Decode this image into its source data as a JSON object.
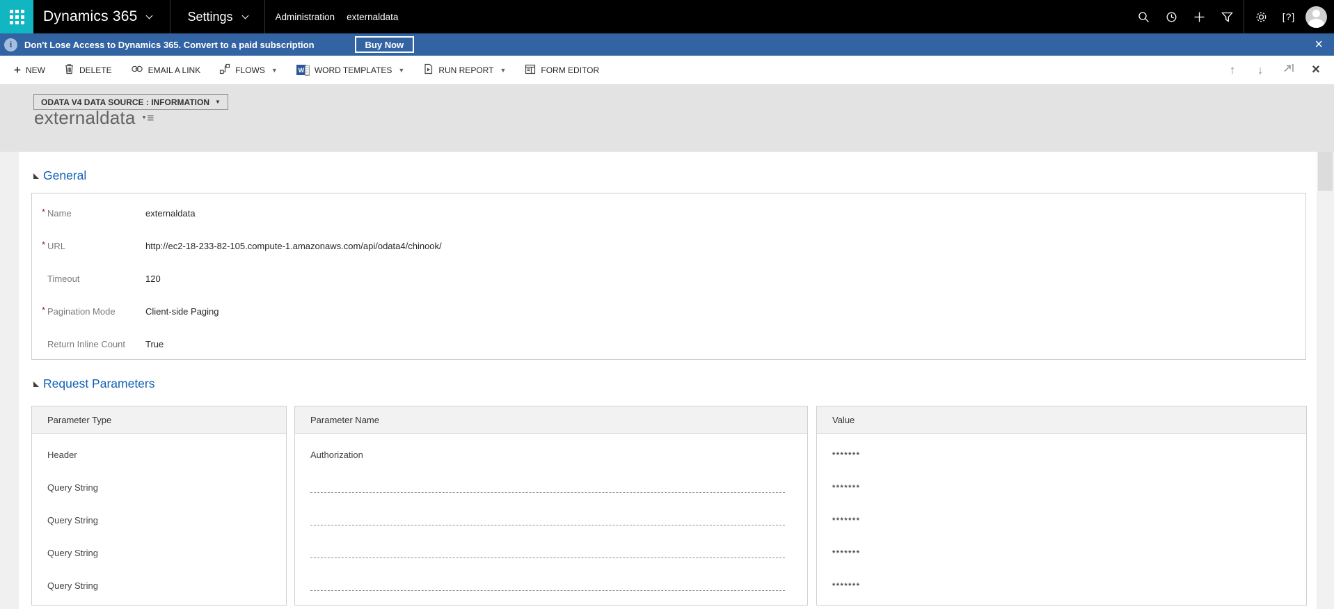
{
  "topbar": {
    "brand": "Dynamics 365",
    "area": "Settings",
    "breadcrumb": [
      "Administration",
      "externaldata"
    ],
    "icons": [
      "app-launcher-waffle",
      "search",
      "recent-history",
      "quick-create-plus",
      "advanced-find-filter",
      "settings-gear",
      "help",
      "user-avatar"
    ]
  },
  "banner": {
    "message": "Don't Lose Access to Dynamics 365. Convert to a paid subscription",
    "cta_label": "Buy Now",
    "close_glyph": "×"
  },
  "toolbar": {
    "items": [
      {
        "label": "NEW",
        "icon": "plus"
      },
      {
        "label": "DELETE",
        "icon": "trash"
      },
      {
        "label": "EMAIL A LINK",
        "icon": "link"
      },
      {
        "label": "FLOWS",
        "icon": "flow",
        "dropdown": true
      },
      {
        "label": "WORD TEMPLATES",
        "icon": "word",
        "dropdown": true
      },
      {
        "label": "RUN REPORT",
        "icon": "report",
        "dropdown": true
      },
      {
        "label": "FORM EDITOR",
        "icon": "form-editor"
      }
    ],
    "word_icon_letter": "W",
    "right_icons": {
      "up": "↑",
      "down": "↓",
      "close": "×"
    }
  },
  "page": {
    "form_selector_label": "ODATA V4 DATA SOURCE : INFORMATION",
    "record_title": "externaldata"
  },
  "general": {
    "title": "General",
    "fields": [
      {
        "label": "Name",
        "required": true,
        "value": "externaldata"
      },
      {
        "label": "URL",
        "required": true,
        "value": "http://ec2-18-233-82-105.compute-1.amazonaws.com/api/odata4/chinook/"
      },
      {
        "label": "Timeout",
        "required": false,
        "value": "120"
      },
      {
        "label": "Pagination Mode",
        "required": true,
        "value": "Client-side Paging"
      },
      {
        "label": "Return Inline Count",
        "required": false,
        "value": "True"
      }
    ]
  },
  "request_parameters": {
    "title": "Request Parameters",
    "columns": [
      "Parameter Type",
      "Parameter Name",
      "Value"
    ],
    "rows": [
      {
        "type": "Header",
        "name": "Authorization",
        "value": "*******"
      },
      {
        "type": "Query String",
        "name": "",
        "value": "*******"
      },
      {
        "type": "Query String",
        "name": "",
        "value": "*******"
      },
      {
        "type": "Query String",
        "name": "",
        "value": "*******"
      },
      {
        "type": "Query String",
        "name": "",
        "value": "*******"
      }
    ]
  },
  "colors": {
    "topbar_bg": "#000000",
    "waffle_teal": "#12b5c2",
    "banner_blue": "#3264a3",
    "section_header_blue": "#1160b7",
    "word_icon_blue": "#2b579a",
    "required_asterisk": "#a61b22",
    "page_gray": "#e3e3e3"
  }
}
